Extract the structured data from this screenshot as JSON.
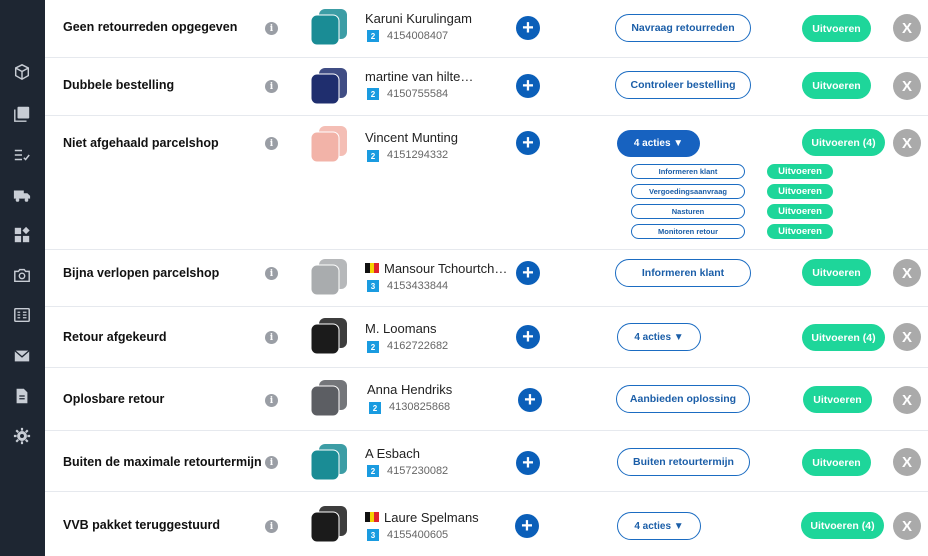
{
  "sidebar": {
    "icons": [
      "box-icon",
      "pdf-icon",
      "list-check-icon",
      "truck-icon",
      "widgets-icon",
      "camera-icon",
      "invoice-icon",
      "mail-icon",
      "document-icon",
      "settings-icon"
    ]
  },
  "rows": [
    {
      "title": "Geen retourreden opgegeven",
      "info": "i",
      "product_color": "#1a8c95",
      "customer": "Karuni Kurulingam",
      "flag": "",
      "badge": "2",
      "order": "4154008407",
      "plus": "+",
      "action": "Navraag retourreden",
      "run": "Uitvoeren",
      "close": "X"
    },
    {
      "title": "Dubbele bestelling",
      "info": "i",
      "product_color": "#1f2e6e",
      "customer": "martine van hilte…",
      "flag": "",
      "badge": "2",
      "order": "4150755584",
      "plus": "+",
      "action": "Controleer bestelling",
      "run": "Uitvoeren",
      "close": "X"
    },
    {
      "title": "Niet afgehaald parcelshop",
      "info": "i",
      "product_color": "#f2b3a8",
      "customer": "Vincent Munting",
      "flag": "",
      "badge": "2",
      "order": "4151294332",
      "plus": "+",
      "action": "4 acties ▼",
      "run": "Uitvoeren (4)",
      "close": "X",
      "sub_actions": [
        {
          "label": "Informeren klant",
          "run": "Uitvoeren"
        },
        {
          "label": "Vergoedingsaanvraag",
          "run": "Uitvoeren"
        },
        {
          "label": "Nasturen",
          "run": "Uitvoeren"
        },
        {
          "label": "Monitoren retour",
          "run": "Uitvoeren"
        }
      ]
    },
    {
      "title": "Bijna verlopen parcelshop",
      "info": "i",
      "product_color": "#a9acae",
      "customer": "Mansour Tchourtch…",
      "flag": "be",
      "badge": "3",
      "order": "4153433844",
      "plus": "+",
      "action": "Informeren klant",
      "run": "Uitvoeren",
      "close": "X"
    },
    {
      "title": "Retour afgekeurd",
      "info": "i",
      "product_color": "#1b1b1b",
      "customer": "M. Loomans",
      "flag": "",
      "badge": "2",
      "order": "4162722682",
      "plus": "+",
      "action": "4 acties ▼",
      "run": "Uitvoeren (4)",
      "close": "X"
    },
    {
      "title": "Oplosbare retour",
      "info": "i",
      "product_color": "#5c5e63",
      "customer": "Anna Hendriks",
      "flag": "",
      "badge": "2",
      "order": "4130825868",
      "plus": "+",
      "action": "Aanbieden oplossing",
      "run": "Uitvoeren",
      "close": "X"
    },
    {
      "title": "Buiten de maximale retourtermijn",
      "info": "i",
      "product_color": "#1a8c95",
      "customer": "A Esbach",
      "flag": "",
      "badge": "2",
      "order": "4157230082",
      "plus": "+",
      "action": "Buiten retourtermijn",
      "run": "Uitvoeren",
      "close": "X"
    },
    {
      "title": "VVB pakket teruggestuurd",
      "info": "i",
      "product_color": "#1b1b1b",
      "customer": "Laure Spelmans",
      "flag": "be",
      "badge": "3",
      "order": "4155400605",
      "plus": "+",
      "action": "4 acties ▼",
      "run": "Uitvoeren (4)",
      "close": "X"
    }
  ]
}
